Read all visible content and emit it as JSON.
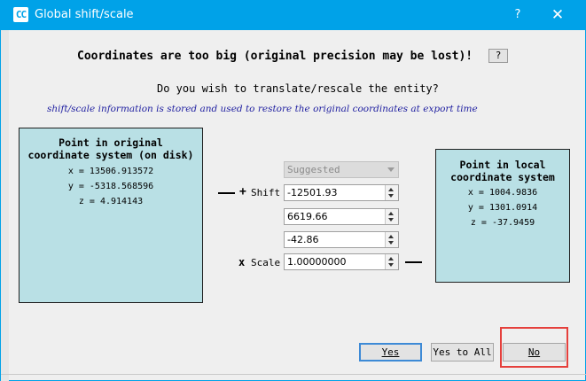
{
  "window": {
    "title": "Global shift/scale",
    "app_icon_text": "CC",
    "help_glyph": "?",
    "close_glyph": "✕",
    "accent_color": "#00a2e8"
  },
  "dialog": {
    "heading": "Coordinates are too big (original precision may be lost)!",
    "heading_help_button": "?",
    "question": "Do you wish to translate/rescale the entity?",
    "info": "shift/scale information is stored and used to restore the original coordinates at export time"
  },
  "original_box": {
    "title_line1": "Point in original",
    "title_line2": "coordinate system (on disk)",
    "x": "x = 13506.913572",
    "y": "y = -5318.568596",
    "z": "z = 4.914143"
  },
  "local_box": {
    "title_line1": "Point in local",
    "title_line2": "coordinate system",
    "x": "x = 1004.9836",
    "y": "y = 1301.0914",
    "z": "z = -37.9459"
  },
  "controls": {
    "plus_glyph": "+",
    "shift_label": "Shift",
    "x_glyph": "x",
    "scale_label": "Scale",
    "preset_value": "Suggested",
    "shift_x": "-12501.93",
    "shift_y": "6619.66",
    "shift_z": "-42.86",
    "scale": "1.00000000"
  },
  "buttons": {
    "yes": "Yes",
    "yes_to_all": "Yes to All",
    "no": "No"
  }
}
